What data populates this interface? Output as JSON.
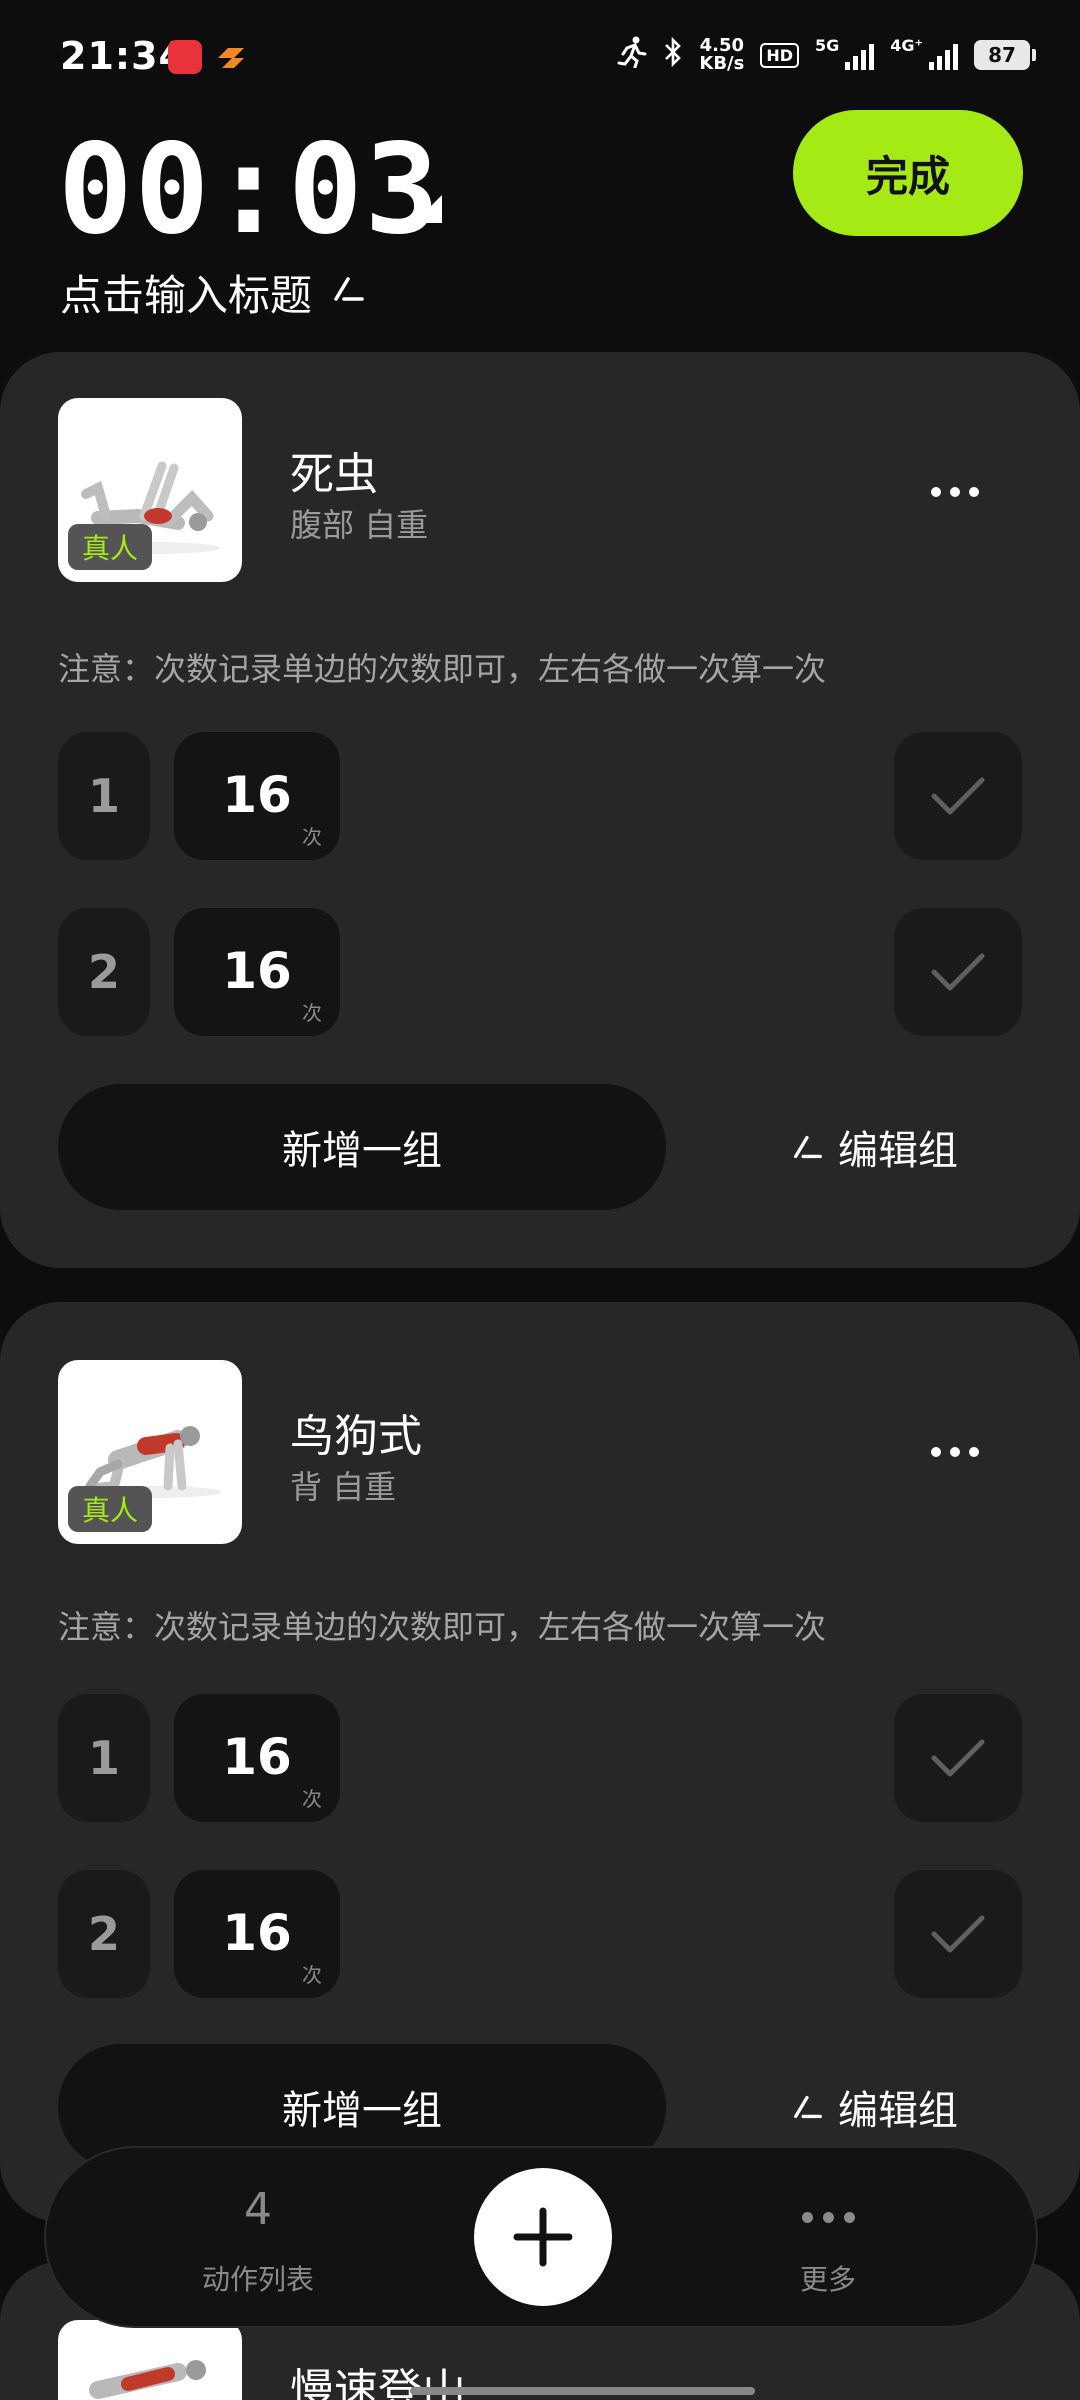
{
  "status_bar": {
    "time": "21:34",
    "speed_value": "4.50",
    "speed_unit": "KB/s",
    "hd_label": "HD",
    "sim1_label": "5G",
    "sim2_label": "4G⁺",
    "battery": "87",
    "app_icons": [
      "app-red-icon",
      "app-orange-icon"
    ],
    "status_icons": [
      "running-icon",
      "bluetooth-icon",
      "hd-icon",
      "signal-5g-icon",
      "signal-4g-icon",
      "battery-icon"
    ]
  },
  "header": {
    "timer": "00:03",
    "finish_label": "完成",
    "title_placeholder": "点击输入标题"
  },
  "exercises": [
    {
      "name": "死虫",
      "meta": "腹部 自重",
      "badge": "真人",
      "note": "注意：次数记录单边的次数即可，左右各做一次算一次",
      "sets": [
        {
          "num": "1",
          "reps": "16",
          "unit": "次"
        },
        {
          "num": "2",
          "reps": "16",
          "unit": "次"
        }
      ],
      "add_set_label": "新增一组",
      "edit_group_label": "编辑组"
    },
    {
      "name": "鸟狗式",
      "meta": "背 自重",
      "badge": "真人",
      "note": "注意：次数记录单边的次数即可，左右各做一次算一次",
      "sets": [
        {
          "num": "1",
          "reps": "16",
          "unit": "次"
        },
        {
          "num": "2",
          "reps": "16",
          "unit": "次"
        }
      ],
      "add_set_label": "新增一组",
      "edit_group_label": "编辑组"
    },
    {
      "name": "慢速登山"
    }
  ],
  "bottom_bar": {
    "list_count": "4",
    "list_label": "动作列表",
    "more_label": "更多"
  },
  "colors": {
    "accent": "#a6ea15",
    "card": "#272727",
    "background": "#0d0d0d"
  }
}
